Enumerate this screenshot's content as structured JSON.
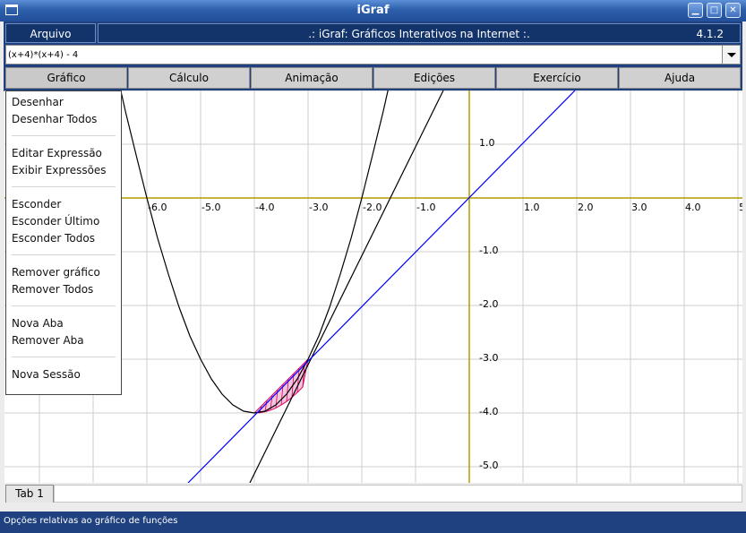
{
  "window": {
    "title": "iGraf"
  },
  "menubar": {
    "arquivo": "Arquivo",
    "banner": ".: iGraf: Gráficos Interativos na Internet :.",
    "version": "4.1.2"
  },
  "expression": {
    "value": "(x+4)*(x+4) - 4"
  },
  "tabs": [
    "Gráfico",
    "Cálculo",
    "Animação",
    "Edições",
    "Exercício",
    "Ajuda"
  ],
  "dropdown": {
    "items": [
      "Desenhar",
      "Desenhar Todos",
      "Editar Expressão",
      "Exibir Expressões",
      "Esconder",
      "Esconder Último",
      "Esconder Todos",
      "Remover gráfico",
      "Remover Todos",
      "Nova Aba",
      "Remover Aba",
      "Nova Sessão"
    ]
  },
  "plot": {
    "x_ticks": [
      "-6.0",
      "-5.0",
      "-4.0",
      "-3.0",
      "-2.0",
      "-1.0",
      "1.0",
      "2.0",
      "3.0",
      "4.0",
      "5"
    ],
    "y_ticks": [
      "1.0",
      "-1.0",
      "-2.0",
      "-3.0",
      "-4.0",
      "-5.0"
    ],
    "curves": [
      {
        "label": "(x+4)*(x+4) - 4",
        "color": "#000000"
      },
      {
        "label": "tangent line",
        "color": "#000000"
      },
      {
        "label": "y = x",
        "color": "#0000ff"
      }
    ],
    "axis_color": "#b39b00",
    "shade_color": "#d9005e"
  },
  "bottom_tabs": [
    "Tab 1"
  ],
  "status": "Opções relativas ao gráfico de funções"
}
